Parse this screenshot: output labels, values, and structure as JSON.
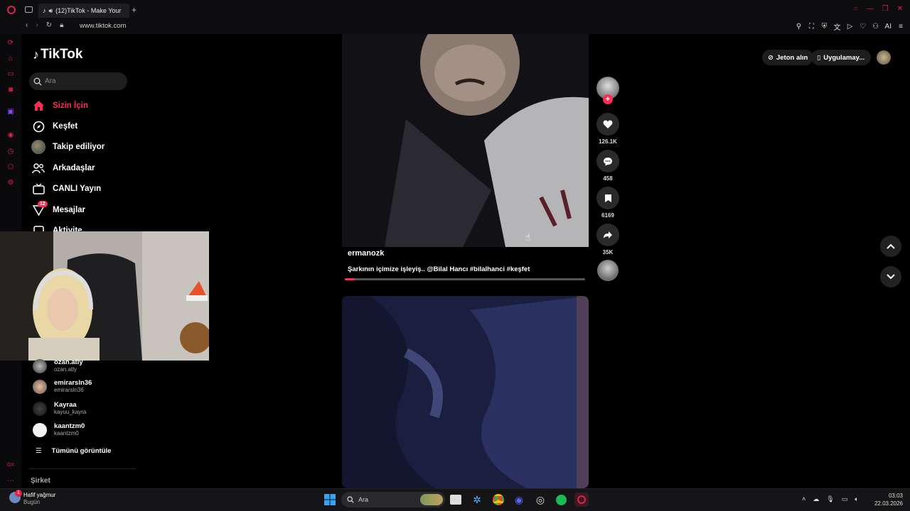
{
  "browser": {
    "tab_title": "(12)TikTok - Make Your",
    "new_tab": "+",
    "url": "www.tiktok.com",
    "toolbar_ai": "AI"
  },
  "tiktok": {
    "logo": "TikTok",
    "search_placeholder": "Ara",
    "nav": [
      {
        "label": "Sizin İçin",
        "icon": "home-icon",
        "active": true
      },
      {
        "label": "Keşfet",
        "icon": "compass-icon"
      },
      {
        "label": "Takip ediliyor",
        "icon": "avatar"
      },
      {
        "label": "Arkadaşlar",
        "icon": "friends-icon"
      },
      {
        "label": "CANLI Yayın",
        "icon": "live-tv-icon"
      },
      {
        "label": "Mesajlar",
        "icon": "messages-icon",
        "badge": "12"
      },
      {
        "label": "Aktivite",
        "icon": "activity-icon"
      }
    ],
    "following": [
      {
        "name": "ozan.atly",
        "user": "ozan.atly"
      },
      {
        "name": "emirarsln36",
        "user": "emirarsln36"
      },
      {
        "name": "Kayraa",
        "user": "kayuu_kayra"
      },
      {
        "name": "kaantzm0",
        "user": "kaantzm0"
      }
    ],
    "see_all": "Tümünü görüntüle",
    "company": "Şirket",
    "coins": "Jeton alın",
    "app": "Uygulamay...",
    "video": {
      "author": "ermanozk",
      "caption": "Şarkının içimize işleyiş.. @Bilal Hancı #bilalhanci #keşfet",
      "progress": 0.04,
      "likes": "126.1K",
      "comments": "458",
      "saves": "6169",
      "shares": "35K"
    }
  },
  "taskbar": {
    "weather_title": "Hafif yağmur",
    "weather_sub": "Bugün",
    "weather_badge": "1",
    "search": "Ara",
    "time": "03:03",
    "date": "22.03.2026"
  },
  "colors": {
    "accent": "#fe2c55",
    "opera": "#e0204a"
  }
}
